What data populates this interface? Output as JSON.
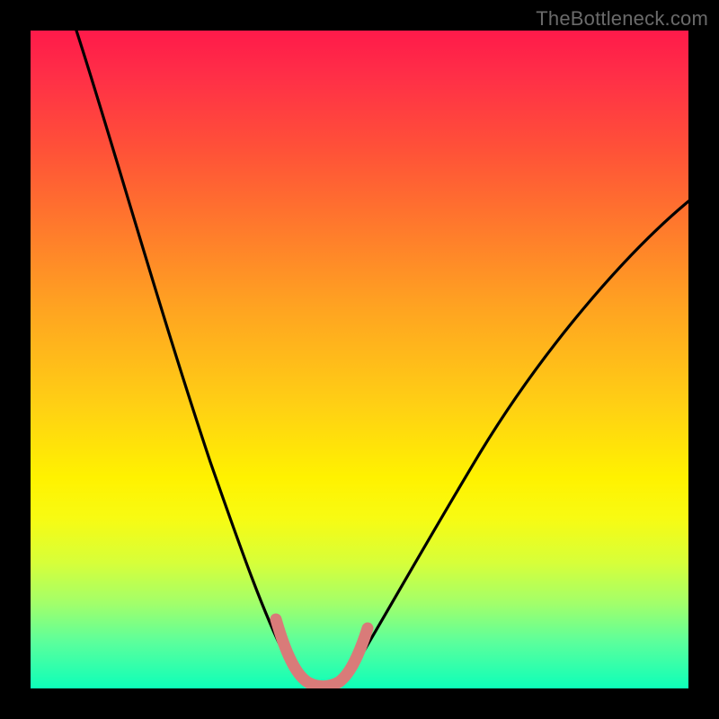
{
  "watermark": "TheBottleneck.com",
  "chart_data": {
    "type": "line",
    "title": "",
    "xlabel": "",
    "ylabel": "",
    "xlim": [
      0,
      100
    ],
    "ylim": [
      0,
      100
    ],
    "series": [
      {
        "name": "bottleneck-curve",
        "x": [
          7,
          10,
          15,
          20,
          25,
          30,
          34,
          37,
          40,
          42,
          44,
          46,
          50,
          55,
          60,
          65,
          70,
          75,
          80,
          85,
          90,
          95,
          100
        ],
        "values": [
          100,
          90,
          76,
          62,
          49,
          36,
          23,
          12,
          5,
          2,
          0,
          0,
          3,
          9,
          16,
          24,
          32,
          40,
          48,
          55,
          62,
          68,
          74
        ]
      },
      {
        "name": "highlight-segment",
        "x": [
          37.5,
          39,
          40.5,
          42,
          43.5,
          45,
          46.5,
          48,
          49.5
        ],
        "values": [
          10.5,
          6.5,
          4.0,
          2.3,
          1.5,
          1.5,
          2.2,
          3.6,
          5.8
        ]
      }
    ],
    "colors": {
      "curve": "#000000",
      "highlight": "#d97b79",
      "gradient_top": "#ff1a4a",
      "gradient_bottom": "#0dffb9"
    }
  }
}
